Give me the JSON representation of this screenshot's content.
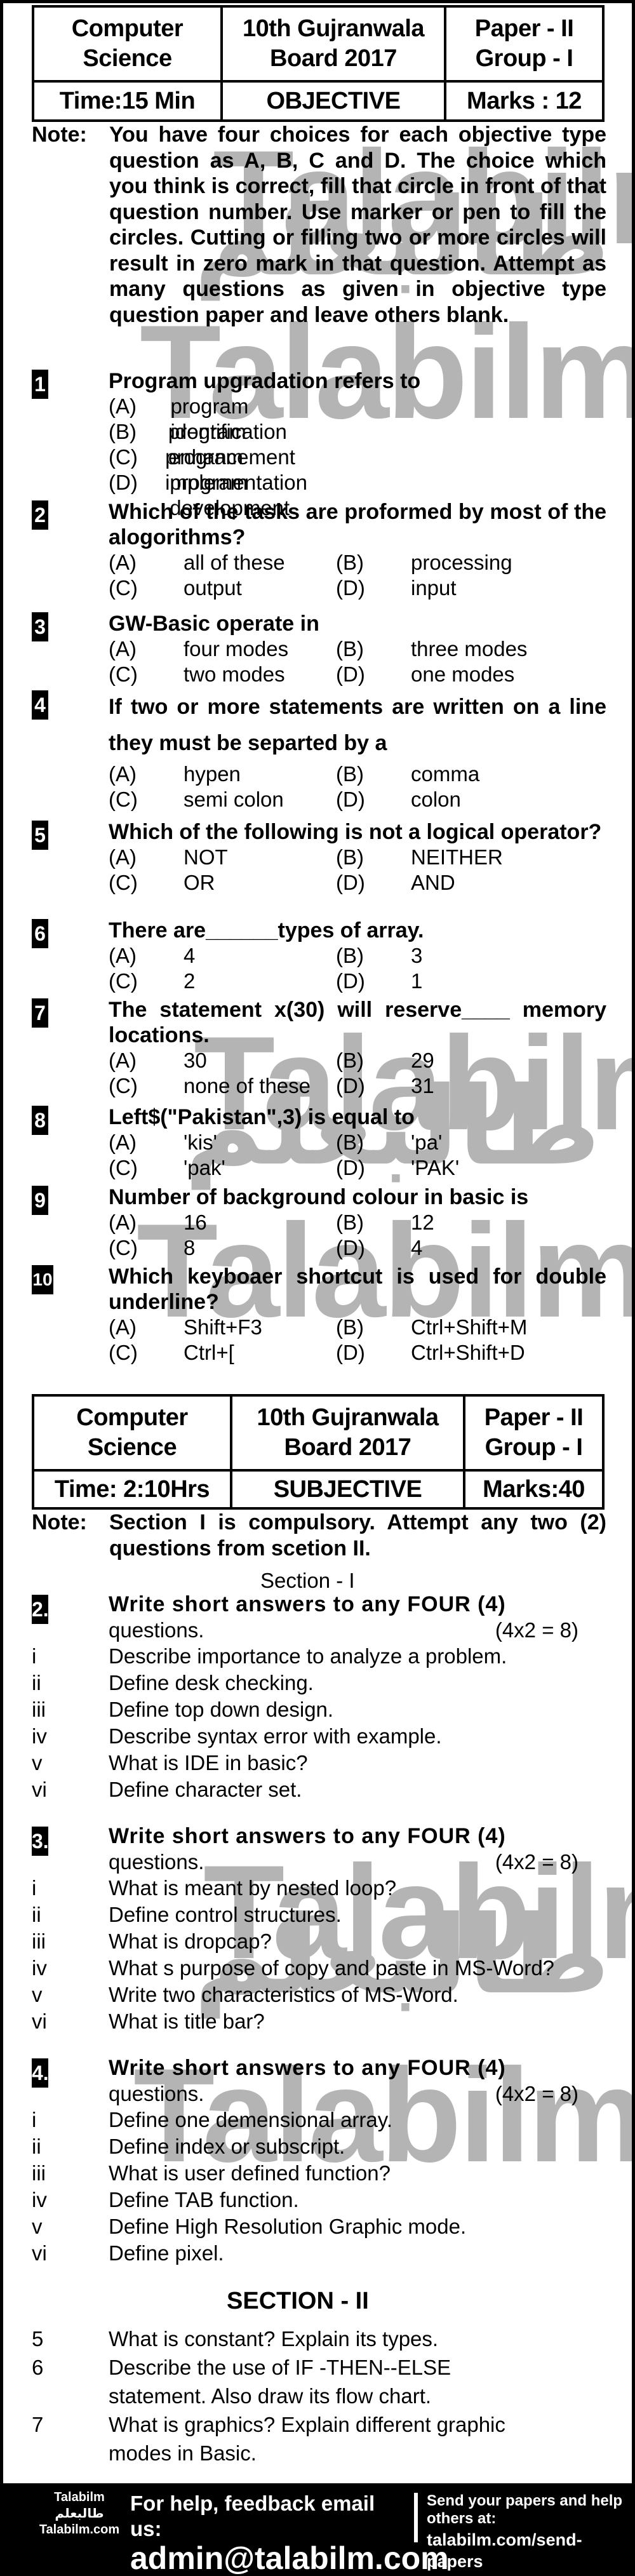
{
  "objective_header": {
    "subject": [
      "Computer",
      "Science"
    ],
    "board": [
      "10th Gujranwala",
      "Board 2017"
    ],
    "paper": [
      "Paper - II",
      "Group - I"
    ],
    "time": "Time:15 Min",
    "type": "OBJECTIVE",
    "marks": "Marks : 12"
  },
  "objective_note": {
    "label": "Note:",
    "text": "You have four choices for each objective type question as A, B, C and D. The choice which you think is correct, fill that circle in front of that question number. Use marker or pen to fill the circles. Cutting or filling two or more circles will result in zero mark in that question. Attempt as many questions as given in objective type question paper and leave others blank."
  },
  "mcqs": [
    {
      "num": "1",
      "question": "Program upgradation refers to",
      "layout": "single",
      "options": [
        {
          "letter": "(A)",
          "text": "program identification"
        },
        {
          "letter": "(B)",
          "text": "program enhancement"
        },
        {
          "letter": "(C)",
          "text": "program implementation"
        },
        {
          "letter": "(D)",
          "text": "program development"
        }
      ]
    },
    {
      "num": "2",
      "question": "Which of the tasks are proformed by most of the alogorithms?",
      "layout": "grid",
      "options": [
        {
          "letter": "(A)",
          "text": "all of these"
        },
        {
          "letter": "(B)",
          "text": "processing"
        },
        {
          "letter": "(C)",
          "text": "output"
        },
        {
          "letter": "(D)",
          "text": "input"
        }
      ]
    },
    {
      "num": "3",
      "question": "GW-Basic operate in",
      "layout": "grid",
      "options": [
        {
          "letter": "(A)",
          "text": "four modes"
        },
        {
          "letter": "(B)",
          "text": "three modes"
        },
        {
          "letter": "(C)",
          "text": "two modes"
        },
        {
          "letter": "(D)",
          "text": "one modes"
        }
      ]
    },
    {
      "num": "4",
      "question": "If two or more statements are written on a line they must be separted by a",
      "layout": "grid",
      "options": [
        {
          "letter": "(A)",
          "text": "hypen"
        },
        {
          "letter": "(B)",
          "text": "comma"
        },
        {
          "letter": "(C)",
          "text": "semi colon"
        },
        {
          "letter": "(D)",
          "text": "colon"
        }
      ]
    },
    {
      "num": "5",
      "question": "Which of the following is not a logical operator?",
      "layout": "grid",
      "options": [
        {
          "letter": "(A)",
          "text": "NOT"
        },
        {
          "letter": "(B)",
          "text": "NEITHER"
        },
        {
          "letter": "(C)",
          "text": "OR"
        },
        {
          "letter": "(D)",
          "text": "AND"
        }
      ]
    },
    {
      "num": "6",
      "question": "There are______types of array.",
      "layout": "grid",
      "options": [
        {
          "letter": "(A)",
          "text": "4"
        },
        {
          "letter": "(B)",
          "text": "3"
        },
        {
          "letter": "(C)",
          "text": "2"
        },
        {
          "letter": "(D)",
          "text": "1"
        }
      ]
    },
    {
      "num": "7",
      "question": "The statement x(30) will reserve____ memory locations.",
      "layout": "grid",
      "options": [
        {
          "letter": "(A)",
          "text": "30"
        },
        {
          "letter": "(B)",
          "text": "29"
        },
        {
          "letter": "(C)",
          "text": "none of these"
        },
        {
          "letter": "(D)",
          "text": "31"
        }
      ]
    },
    {
      "num": "8",
      "question": "Left$(\"Pakistan\",3) is equal to",
      "layout": "grid",
      "options": [
        {
          "letter": "(A)",
          "text": "'kis'"
        },
        {
          "letter": "(B)",
          "text": "'pa'"
        },
        {
          "letter": "(C)",
          "text": "'pak'"
        },
        {
          "letter": "(D)",
          "text": "'PAK'"
        }
      ]
    },
    {
      "num": "9",
      "question": "Number of background colour in basic is",
      "layout": "grid",
      "options": [
        {
          "letter": "(A)",
          "text": "16"
        },
        {
          "letter": "(B)",
          "text": "12"
        },
        {
          "letter": "(C)",
          "text": "8"
        },
        {
          "letter": "(D)",
          "text": "4"
        }
      ]
    },
    {
      "num": "10",
      "question": "Which keyboaer shortcut is used for double underline?",
      "layout": "grid",
      "options": [
        {
          "letter": "(A)",
          "text": "Shift+F3"
        },
        {
          "letter": "(B)",
          "text": "Ctrl+Shift+M"
        },
        {
          "letter": "(C)",
          "text": "Ctrl+["
        },
        {
          "letter": "(D)",
          "text": "Ctrl+Shift+D"
        }
      ]
    }
  ],
  "subjective_header": {
    "subject": [
      "Computer",
      "Science"
    ],
    "board": [
      "10th Gujranwala",
      "Board 2017"
    ],
    "paper": [
      "Paper - II",
      "Group - I"
    ],
    "time": "Time: 2:10Hrs",
    "type": "SUBJECTIVE",
    "marks": "Marks:40"
  },
  "subjective_note": {
    "label": "Note:",
    "text": "Section I is compulsory. Attempt any two (2) questions from scetion II."
  },
  "section1": {
    "title": "Section - I",
    "questions": [
      {
        "num": "2.",
        "instruction": "Write short answers to any FOUR (4)",
        "instruction2": "questions.",
        "marks": "(4x2 = 8)",
        "parts": [
          {
            "roman": "i",
            "text": "Describe importance to analyze a problem."
          },
          {
            "roman": "ii",
            "text": "Define desk checking."
          },
          {
            "roman": "iii",
            "text": "Define top down design."
          },
          {
            "roman": "iv",
            "text": "Describe syntax error with example."
          },
          {
            "roman": "v",
            "text": "What is IDE in basic?"
          },
          {
            "roman": "vi",
            "text": "Define character set."
          }
        ]
      },
      {
        "num": "3.",
        "instruction": "Write short answers to any FOUR (4)",
        "instruction2": "questions.",
        "marks": "(4x2 = 8)",
        "parts": [
          {
            "roman": "i",
            "text": "What is meant by nested loop?"
          },
          {
            "roman": "ii",
            "text": "Define control structures."
          },
          {
            "roman": "iii",
            "text": "What is dropcap?"
          },
          {
            "roman": "iv",
            "text": "What s purpose of copy and paste in MS-Word?"
          },
          {
            "roman": "v",
            "text": "Write two characteristics of MS-Word."
          },
          {
            "roman": "vi",
            "text": "What is title bar?"
          }
        ]
      },
      {
        "num": "4.",
        "instruction": "Write short answers to any FOUR (4)",
        "instruction2": "questions.",
        "marks": "(4x2 = 8)",
        "parts": [
          {
            "roman": "i",
            "text": "Define one demensional array."
          },
          {
            "roman": "ii",
            "text": "Define index or subscript."
          },
          {
            "roman": "iii",
            "text": "What is user defined function?"
          },
          {
            "roman": "iv",
            "text": "Define TAB function."
          },
          {
            "roman": "v",
            "text": "Define High Resolution Graphic mode."
          },
          {
            "roman": "vi",
            "text": "Define pixel."
          }
        ]
      }
    ]
  },
  "section2": {
    "title": "SECTION - II",
    "questions": [
      {
        "num": "5",
        "lines": [
          "What is constant? Explain its types."
        ]
      },
      {
        "num": "6",
        "lines": [
          "Describe the use of IF -THEN--ELSE",
          "statement. Also draw its flow chart."
        ]
      },
      {
        "num": "7",
        "lines": [
          "What is graphics? Explain different graphic",
          "modes in Basic."
        ]
      }
    ]
  },
  "watermarks": {
    "latin": "Talabilm",
    "latin_com": "Talabilm.com",
    "arabic": "طالبعلم"
  },
  "footer": {
    "logo_line1": "Talabilm",
    "logo_line2": "طالبعلم",
    "logo_line3": "Talabilm.com",
    "help_text": "For help, feedback email us:",
    "email": "admin@talabilm.com",
    "send_text": "Send your papers and help others at:",
    "send_url": "talabilm.com/send-papers"
  }
}
